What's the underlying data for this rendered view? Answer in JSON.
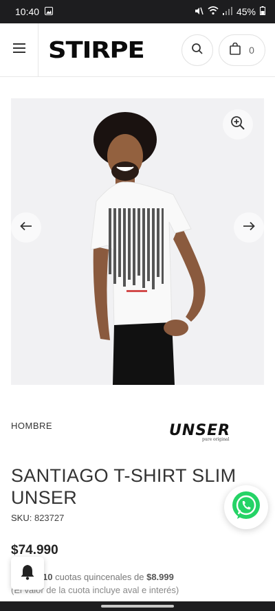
{
  "status_bar": {
    "time": "10:40",
    "battery": "45%"
  },
  "header": {
    "logo_text": "STIRPE",
    "cart_count": "0"
  },
  "product": {
    "category": "HOMBRE",
    "brand": "UNSER",
    "brand_tagline": "pure original",
    "title": "SANTIAGO T-SHIRT SLIM UNSER",
    "sku_label": "SKU",
    "sku_value": "823727",
    "price": "$74.990",
    "installments_count": "10",
    "installments_text": "cuotas quincenales de",
    "installment_amount": "$8.999",
    "installment_note": "(El valor de la cuota incluye aval e interés)"
  },
  "colors": {
    "whatsapp_green": "#25d366",
    "header_dark": "#1d1d1f"
  },
  "icons": {
    "menu": "hamburger-icon",
    "search": "search-icon",
    "cart": "shopping-bag-icon",
    "zoom": "zoom-in-icon",
    "prev": "arrow-left-icon",
    "next": "arrow-right-icon",
    "whatsapp": "whatsapp-icon",
    "notification": "bell-icon"
  }
}
